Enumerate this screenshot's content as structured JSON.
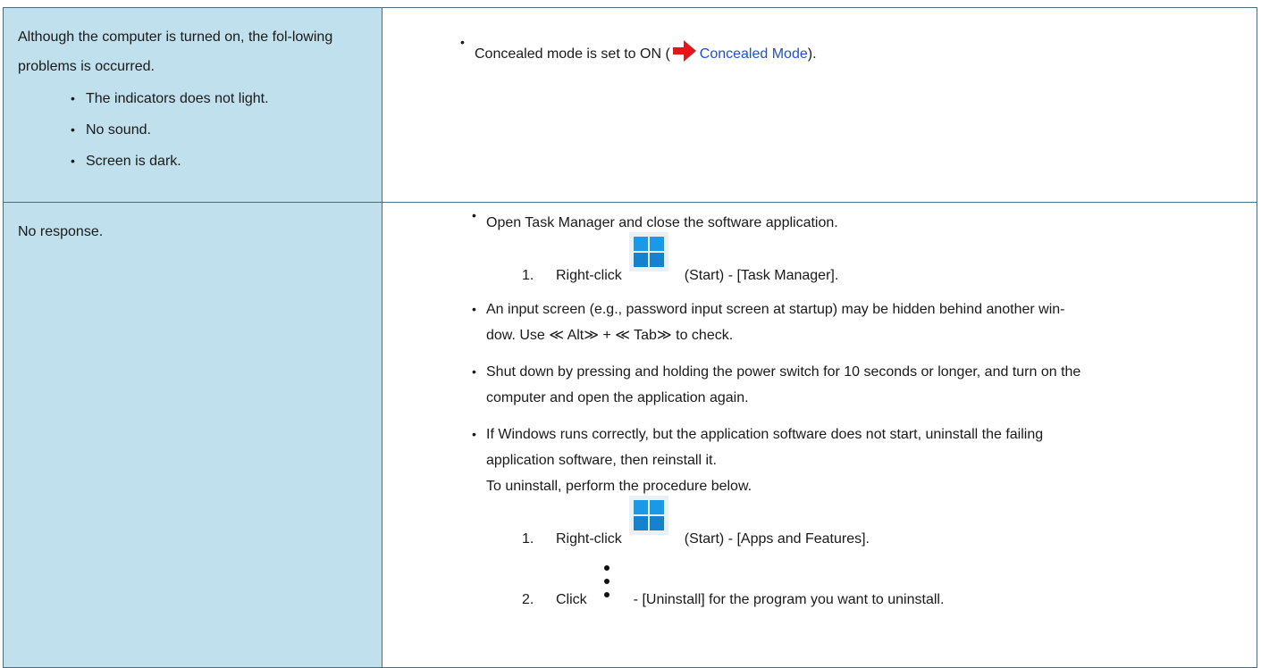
{
  "rows": [
    {
      "problem": {
        "text": "Although the computer is turned on, the fol-lowing problems is occurred.",
        "symptoms": [
          "The indicators does not light.",
          "No sound.",
          "Screen is dark."
        ]
      },
      "solution": {
        "bullet": "•",
        "prefix": "Concealed mode is set to ON (",
        "link": "Concealed Mode",
        "suffix": ")."
      }
    },
    {
      "problem": {
        "text": "No response."
      },
      "solution": {
        "items": [
          {
            "text": "Open Task Manager and close the software application.",
            "steps": [
              {
                "num": "1.",
                "before": "Right-click",
                "after": "(Start) - [Task Manager]."
              }
            ]
          },
          {
            "line1": "An input screen (e.g., password input screen at startup) may be hidden behind another win-",
            "line2": "dow. Use ≪ Alt≫ + ≪ Tab≫ to check."
          },
          {
            "line1": "Shut down by pressing and holding the power switch for 10 seconds or longer, and turn on the",
            "line2": "computer and open the application again."
          },
          {
            "line1": "If Windows runs correctly, but the application software does not start, uninstall the failing",
            "line2": "application software, then reinstall it.",
            "line3": "To uninstall, perform the procedure below.",
            "steps": [
              {
                "num": "1.",
                "before": "Right-click",
                "after": "(Start) - [Apps and Features]."
              },
              {
                "num": "2.",
                "before": "Click",
                "after": "- [Uninstall] for the program you want to uninstall."
              }
            ]
          }
        ]
      }
    }
  ],
  "icons": {
    "arrow": "red-arrow-icon",
    "start": "windows-start-icon",
    "more": "more-options-icon"
  },
  "colors": {
    "problem_bg": "#bfe0ec",
    "border": "#4a6d82",
    "link": "#1f4fd6",
    "arrow": "#e8141b",
    "win_tile": "#1a9ae6"
  }
}
